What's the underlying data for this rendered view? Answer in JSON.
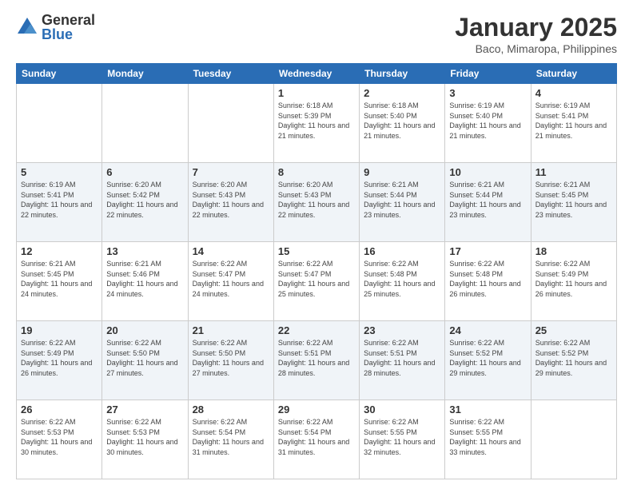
{
  "header": {
    "logo_general": "General",
    "logo_blue": "Blue",
    "title": "January 2025",
    "subtitle": "Baco, Mimaropa, Philippines"
  },
  "days_of_week": [
    "Sunday",
    "Monday",
    "Tuesday",
    "Wednesday",
    "Thursday",
    "Friday",
    "Saturday"
  ],
  "weeks": [
    [
      {
        "day": "",
        "info": ""
      },
      {
        "day": "",
        "info": ""
      },
      {
        "day": "",
        "info": ""
      },
      {
        "day": "1",
        "info": "Sunrise: 6:18 AM\nSunset: 5:39 PM\nDaylight: 11 hours and 21 minutes."
      },
      {
        "day": "2",
        "info": "Sunrise: 6:18 AM\nSunset: 5:40 PM\nDaylight: 11 hours and 21 minutes."
      },
      {
        "day": "3",
        "info": "Sunrise: 6:19 AM\nSunset: 5:40 PM\nDaylight: 11 hours and 21 minutes."
      },
      {
        "day": "4",
        "info": "Sunrise: 6:19 AM\nSunset: 5:41 PM\nDaylight: 11 hours and 21 minutes."
      }
    ],
    [
      {
        "day": "5",
        "info": "Sunrise: 6:19 AM\nSunset: 5:41 PM\nDaylight: 11 hours and 22 minutes."
      },
      {
        "day": "6",
        "info": "Sunrise: 6:20 AM\nSunset: 5:42 PM\nDaylight: 11 hours and 22 minutes."
      },
      {
        "day": "7",
        "info": "Sunrise: 6:20 AM\nSunset: 5:43 PM\nDaylight: 11 hours and 22 minutes."
      },
      {
        "day": "8",
        "info": "Sunrise: 6:20 AM\nSunset: 5:43 PM\nDaylight: 11 hours and 22 minutes."
      },
      {
        "day": "9",
        "info": "Sunrise: 6:21 AM\nSunset: 5:44 PM\nDaylight: 11 hours and 23 minutes."
      },
      {
        "day": "10",
        "info": "Sunrise: 6:21 AM\nSunset: 5:44 PM\nDaylight: 11 hours and 23 minutes."
      },
      {
        "day": "11",
        "info": "Sunrise: 6:21 AM\nSunset: 5:45 PM\nDaylight: 11 hours and 23 minutes."
      }
    ],
    [
      {
        "day": "12",
        "info": "Sunrise: 6:21 AM\nSunset: 5:45 PM\nDaylight: 11 hours and 24 minutes."
      },
      {
        "day": "13",
        "info": "Sunrise: 6:21 AM\nSunset: 5:46 PM\nDaylight: 11 hours and 24 minutes."
      },
      {
        "day": "14",
        "info": "Sunrise: 6:22 AM\nSunset: 5:47 PM\nDaylight: 11 hours and 24 minutes."
      },
      {
        "day": "15",
        "info": "Sunrise: 6:22 AM\nSunset: 5:47 PM\nDaylight: 11 hours and 25 minutes."
      },
      {
        "day": "16",
        "info": "Sunrise: 6:22 AM\nSunset: 5:48 PM\nDaylight: 11 hours and 25 minutes."
      },
      {
        "day": "17",
        "info": "Sunrise: 6:22 AM\nSunset: 5:48 PM\nDaylight: 11 hours and 26 minutes."
      },
      {
        "day": "18",
        "info": "Sunrise: 6:22 AM\nSunset: 5:49 PM\nDaylight: 11 hours and 26 minutes."
      }
    ],
    [
      {
        "day": "19",
        "info": "Sunrise: 6:22 AM\nSunset: 5:49 PM\nDaylight: 11 hours and 26 minutes."
      },
      {
        "day": "20",
        "info": "Sunrise: 6:22 AM\nSunset: 5:50 PM\nDaylight: 11 hours and 27 minutes."
      },
      {
        "day": "21",
        "info": "Sunrise: 6:22 AM\nSunset: 5:50 PM\nDaylight: 11 hours and 27 minutes."
      },
      {
        "day": "22",
        "info": "Sunrise: 6:22 AM\nSunset: 5:51 PM\nDaylight: 11 hours and 28 minutes."
      },
      {
        "day": "23",
        "info": "Sunrise: 6:22 AM\nSunset: 5:51 PM\nDaylight: 11 hours and 28 minutes."
      },
      {
        "day": "24",
        "info": "Sunrise: 6:22 AM\nSunset: 5:52 PM\nDaylight: 11 hours and 29 minutes."
      },
      {
        "day": "25",
        "info": "Sunrise: 6:22 AM\nSunset: 5:52 PM\nDaylight: 11 hours and 29 minutes."
      }
    ],
    [
      {
        "day": "26",
        "info": "Sunrise: 6:22 AM\nSunset: 5:53 PM\nDaylight: 11 hours and 30 minutes."
      },
      {
        "day": "27",
        "info": "Sunrise: 6:22 AM\nSunset: 5:53 PM\nDaylight: 11 hours and 30 minutes."
      },
      {
        "day": "28",
        "info": "Sunrise: 6:22 AM\nSunset: 5:54 PM\nDaylight: 11 hours and 31 minutes."
      },
      {
        "day": "29",
        "info": "Sunrise: 6:22 AM\nSunset: 5:54 PM\nDaylight: 11 hours and 31 minutes."
      },
      {
        "day": "30",
        "info": "Sunrise: 6:22 AM\nSunset: 5:55 PM\nDaylight: 11 hours and 32 minutes."
      },
      {
        "day": "31",
        "info": "Sunrise: 6:22 AM\nSunset: 5:55 PM\nDaylight: 11 hours and 33 minutes."
      },
      {
        "day": "",
        "info": ""
      }
    ]
  ]
}
